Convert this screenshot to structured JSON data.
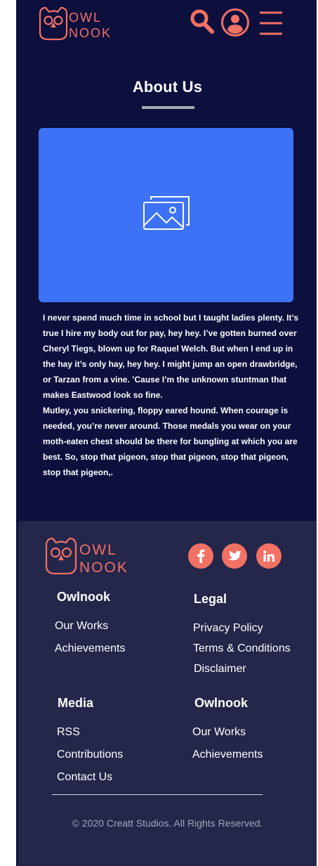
{
  "brand": {
    "name_line1": "OWL",
    "name_line2": "NOOK",
    "accent_color": "#f27165",
    "header_bg": "#0d0f3d",
    "footer_bg": "#24264a"
  },
  "header": {
    "icons": [
      "search-icon",
      "user-icon",
      "menu-icon"
    ]
  },
  "about": {
    "title": "About Us",
    "image_icon": "image-placeholder-icon",
    "image_bg": "#3d72f6",
    "paragraph1": "I never spend much time in school but I taught ladies plenty. It’s true I hire my body out for pay, hey hey. I’ve gotten burned over Cheryl Tiegs, blown up for Raquel Welch. But when I end up in the hay it’s only hay, hey hey. I might jump an open drawbridge, or Tarzan from a vine. ’Cause I’m the unknown stuntman that makes Eastwood look so fine.",
    "paragraph2": "Mutley, you snickering, floppy eared hound. When courage is needed, you’re never around. Those medals you wear on your moth-eaten chest should be there for bungling at which you are best. So, stop that pigeon, stop that pigeon, stop that pigeon, stop that pigeon,."
  },
  "footer": {
    "social": [
      "facebook-icon",
      "twitter-icon",
      "linkedin-icon"
    ],
    "col1": {
      "title": "Owlnook",
      "links": [
        "Our Works",
        "Achievements"
      ]
    },
    "col2": {
      "title": "Legal",
      "links": [
        "Privacy Policy",
        "Terms & Conditions",
        "Disclaimer"
      ]
    },
    "col3": {
      "title": "Media",
      "links": [
        "RSS",
        "Contributions",
        "Contact Us"
      ]
    },
    "col4": {
      "title": "Owlnook",
      "links": [
        "Our Works",
        "Achievements"
      ]
    },
    "copyright": "© 2020 Creatt Studios. All Rights Reserved."
  }
}
